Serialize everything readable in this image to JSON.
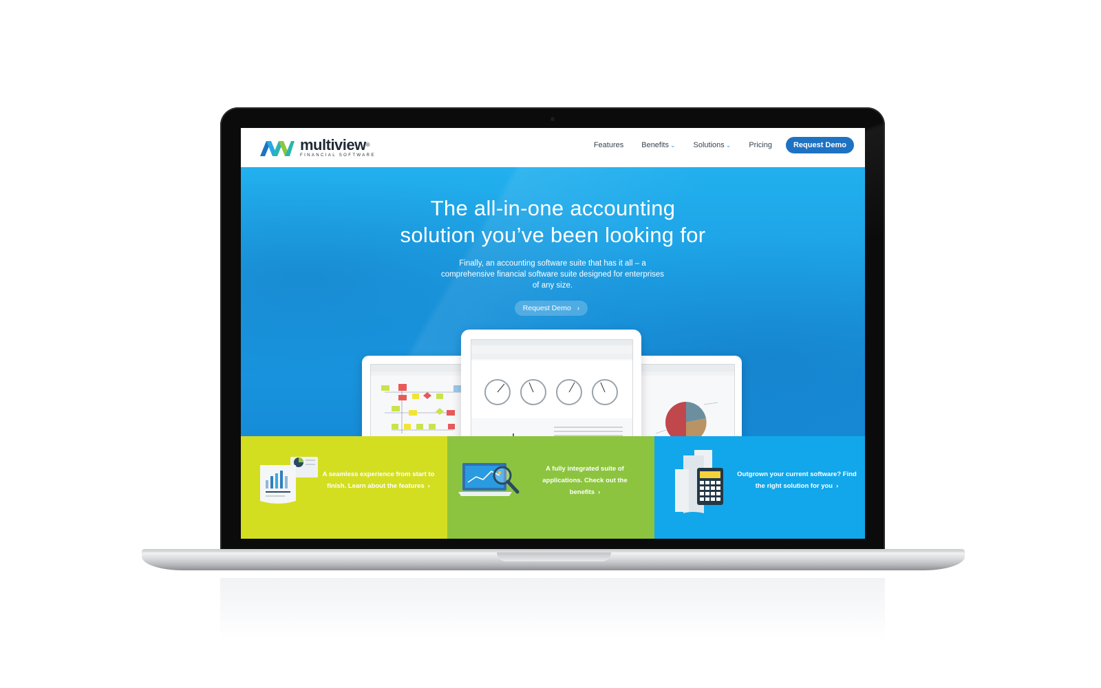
{
  "nav": {
    "logo_name": "multiview",
    "logo_registered": "®",
    "logo_tagline": "FINANCIAL SOFTWARE",
    "items": [
      {
        "label": "Features",
        "dropdown": false
      },
      {
        "label": "Benefits",
        "dropdown": true
      },
      {
        "label": "Solutions",
        "dropdown": true
      },
      {
        "label": "Pricing",
        "dropdown": false
      }
    ],
    "cta_label": "Request Demo"
  },
  "hero": {
    "title_line1": "The all-in-one accounting",
    "title_line2": "solution you’ve been looking for",
    "subtitle_line1": "Finally, an accounting software suite that has it all – a",
    "subtitle_line2": "comprehensive financial software suite designed for enterprises",
    "subtitle_line3": "of any size.",
    "cta_label": "Request Demo",
    "cta_icon": "chevron-right-icon"
  },
  "tiles": [
    {
      "text_line1": "A seamless experience from start to",
      "text_line2": "finish. Learn about the features",
      "icon": "report-chart-icon",
      "color": "#d4de21"
    },
    {
      "text_line1": "A fully integrated suite of",
      "text_line2": "applications. Check out the",
      "text_line3": "benefits",
      "icon": "laptop-magnifier-icon",
      "color": "#8cc43f"
    },
    {
      "text_line1": "Outgrown your current software? Find",
      "text_line2": "the right solution for you",
      "icon": "calculator-receipt-icon",
      "color": "#12a7ea"
    }
  ],
  "colors": {
    "brand_blue": "#1e72c2",
    "hero_blue": "#1a98e0",
    "tile_yellow": "#d4de21",
    "tile_green": "#8cc43f",
    "tile_blue": "#12a7ea"
  }
}
